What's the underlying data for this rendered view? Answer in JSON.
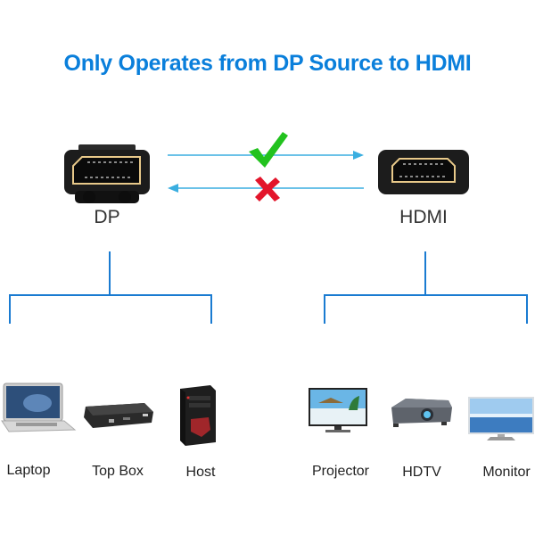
{
  "title": "Only Operates from DP Source to HDMI",
  "colors": {
    "title": "#0a7fdb",
    "tree_lines": "#1a7bd1",
    "arrows": "#3aaee0",
    "check": "#22c21e",
    "cross": "#e3152b",
    "connector_gold": "#e8c98a"
  },
  "source": {
    "label": "DP",
    "icon": "displayport-connector-icon",
    "devices": [
      {
        "label": "Laptop",
        "icon": "laptop-icon"
      },
      {
        "label": "Top Box",
        "icon": "set-top-box-icon"
      },
      {
        "label": "Host",
        "icon": "desktop-tower-icon"
      }
    ]
  },
  "target": {
    "label": "HDMI",
    "icon": "hdmi-connector-icon",
    "devices": [
      {
        "label": "Projector",
        "icon": "tv-icon"
      },
      {
        "label": "HDTV",
        "icon": "projector-icon"
      },
      {
        "label": "Monitor",
        "icon": "monitor-icon"
      }
    ]
  },
  "directions": [
    {
      "from": "DP",
      "to": "HDMI",
      "supported": true,
      "mark": "check-icon"
    },
    {
      "from": "HDMI",
      "to": "DP",
      "supported": false,
      "mark": "cross-icon"
    }
  ]
}
